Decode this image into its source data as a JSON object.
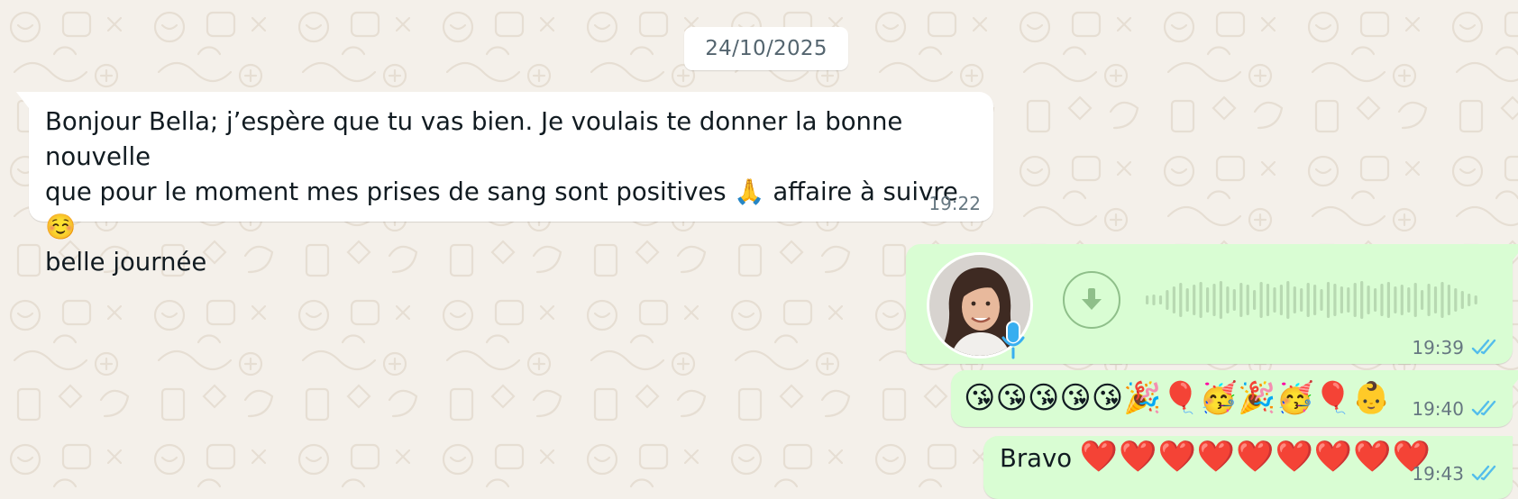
{
  "date_separator": "24/10/2025",
  "messages": [
    {
      "direction": "incoming",
      "text": "Bonjour Bella; j’espère que tu vas bien. Je voulais te donner la bonne nouvelle\nque pour le moment mes prises de sang sont positives 🙏 affaire à suivre ☺️\nbelle journée",
      "time": "19:22"
    },
    {
      "direction": "outgoing",
      "type": "voice_note",
      "time": "19:39",
      "status": "read"
    },
    {
      "direction": "outgoing",
      "text": "😘😘😘😘😘🎉🎈🥳🎉🥳🎈👶",
      "time": "19:40",
      "status": "read"
    },
    {
      "direction": "outgoing",
      "text": "Bravo",
      "emoji": "❤️❤️❤️❤️❤️❤️❤️❤️❤️",
      "time": "19:43",
      "status": "read"
    }
  ],
  "icons": {
    "download": "download-arrow-icon",
    "mic": "microphone-icon",
    "read_receipt": "double-check-icon"
  },
  "colors": {
    "incoming_bubble": "#ffffff",
    "outgoing_bubble": "#d9fdd3",
    "read_tick": "#53bdeb",
    "wallpaper": "#f4f0ea",
    "mic_badge": "#38aef0"
  }
}
